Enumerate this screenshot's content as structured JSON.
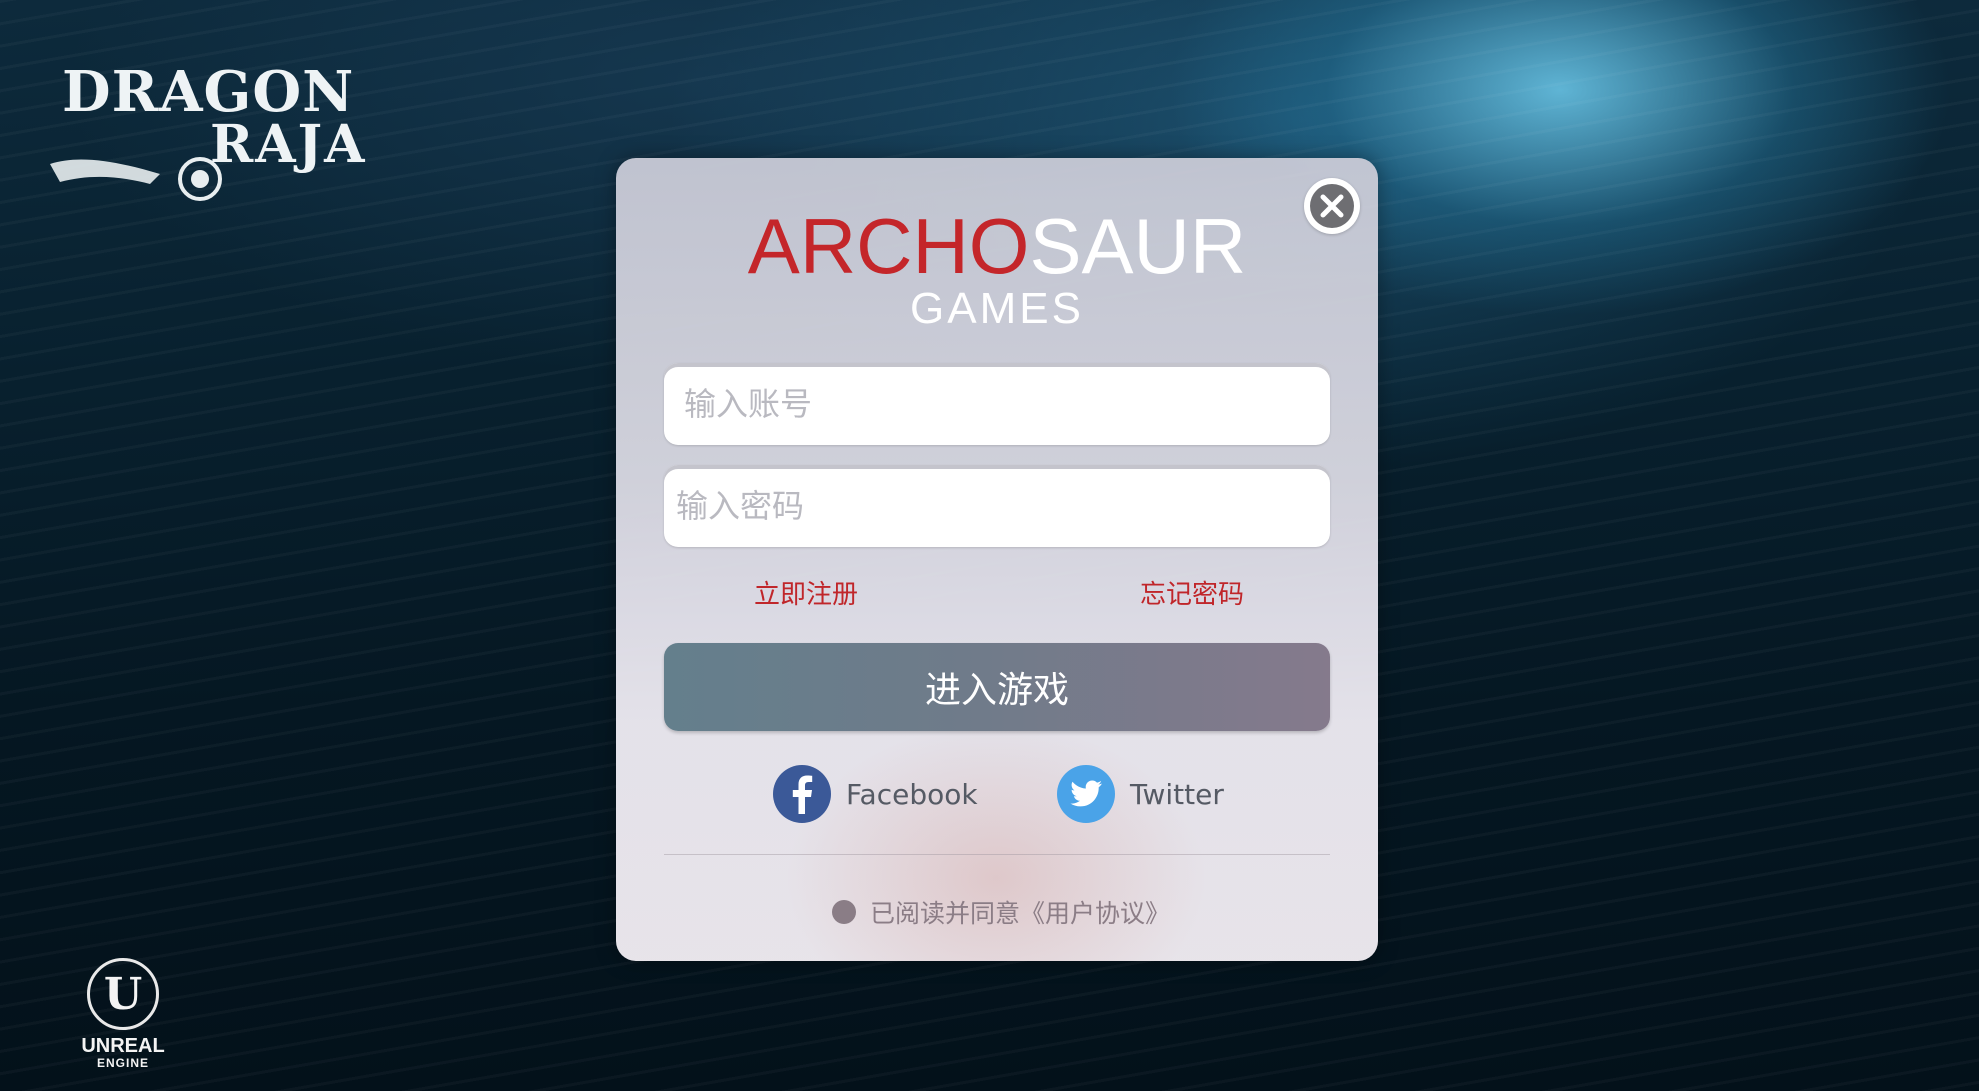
{
  "game": {
    "logo_line1": "DRAGON",
    "logo_line2": "RAJA"
  },
  "engine": {
    "name": "UNREAL",
    "sub": "ENGINE",
    "mark": "U"
  },
  "dialog": {
    "brand_red": "ARCHO",
    "brand_white": "SAUR",
    "brand_sub": "GAMES",
    "account_placeholder": "输入账号",
    "password_placeholder": "输入密码",
    "register_label": "立即注册",
    "forgot_label": "忘记密码",
    "enter_label": "进入游戏",
    "facebook_label": "Facebook",
    "twitter_label": "Twitter",
    "agreement_text": "已阅读并同意《用户协议》"
  },
  "colors": {
    "brand_red": "#c4262a",
    "link_red": "#c0262a",
    "facebook_blue": "#3b5998",
    "twitter_blue": "#4aa3e8"
  },
  "icons": [
    "close-icon",
    "facebook-icon",
    "twitter-icon",
    "dragon-wing-icon"
  ]
}
